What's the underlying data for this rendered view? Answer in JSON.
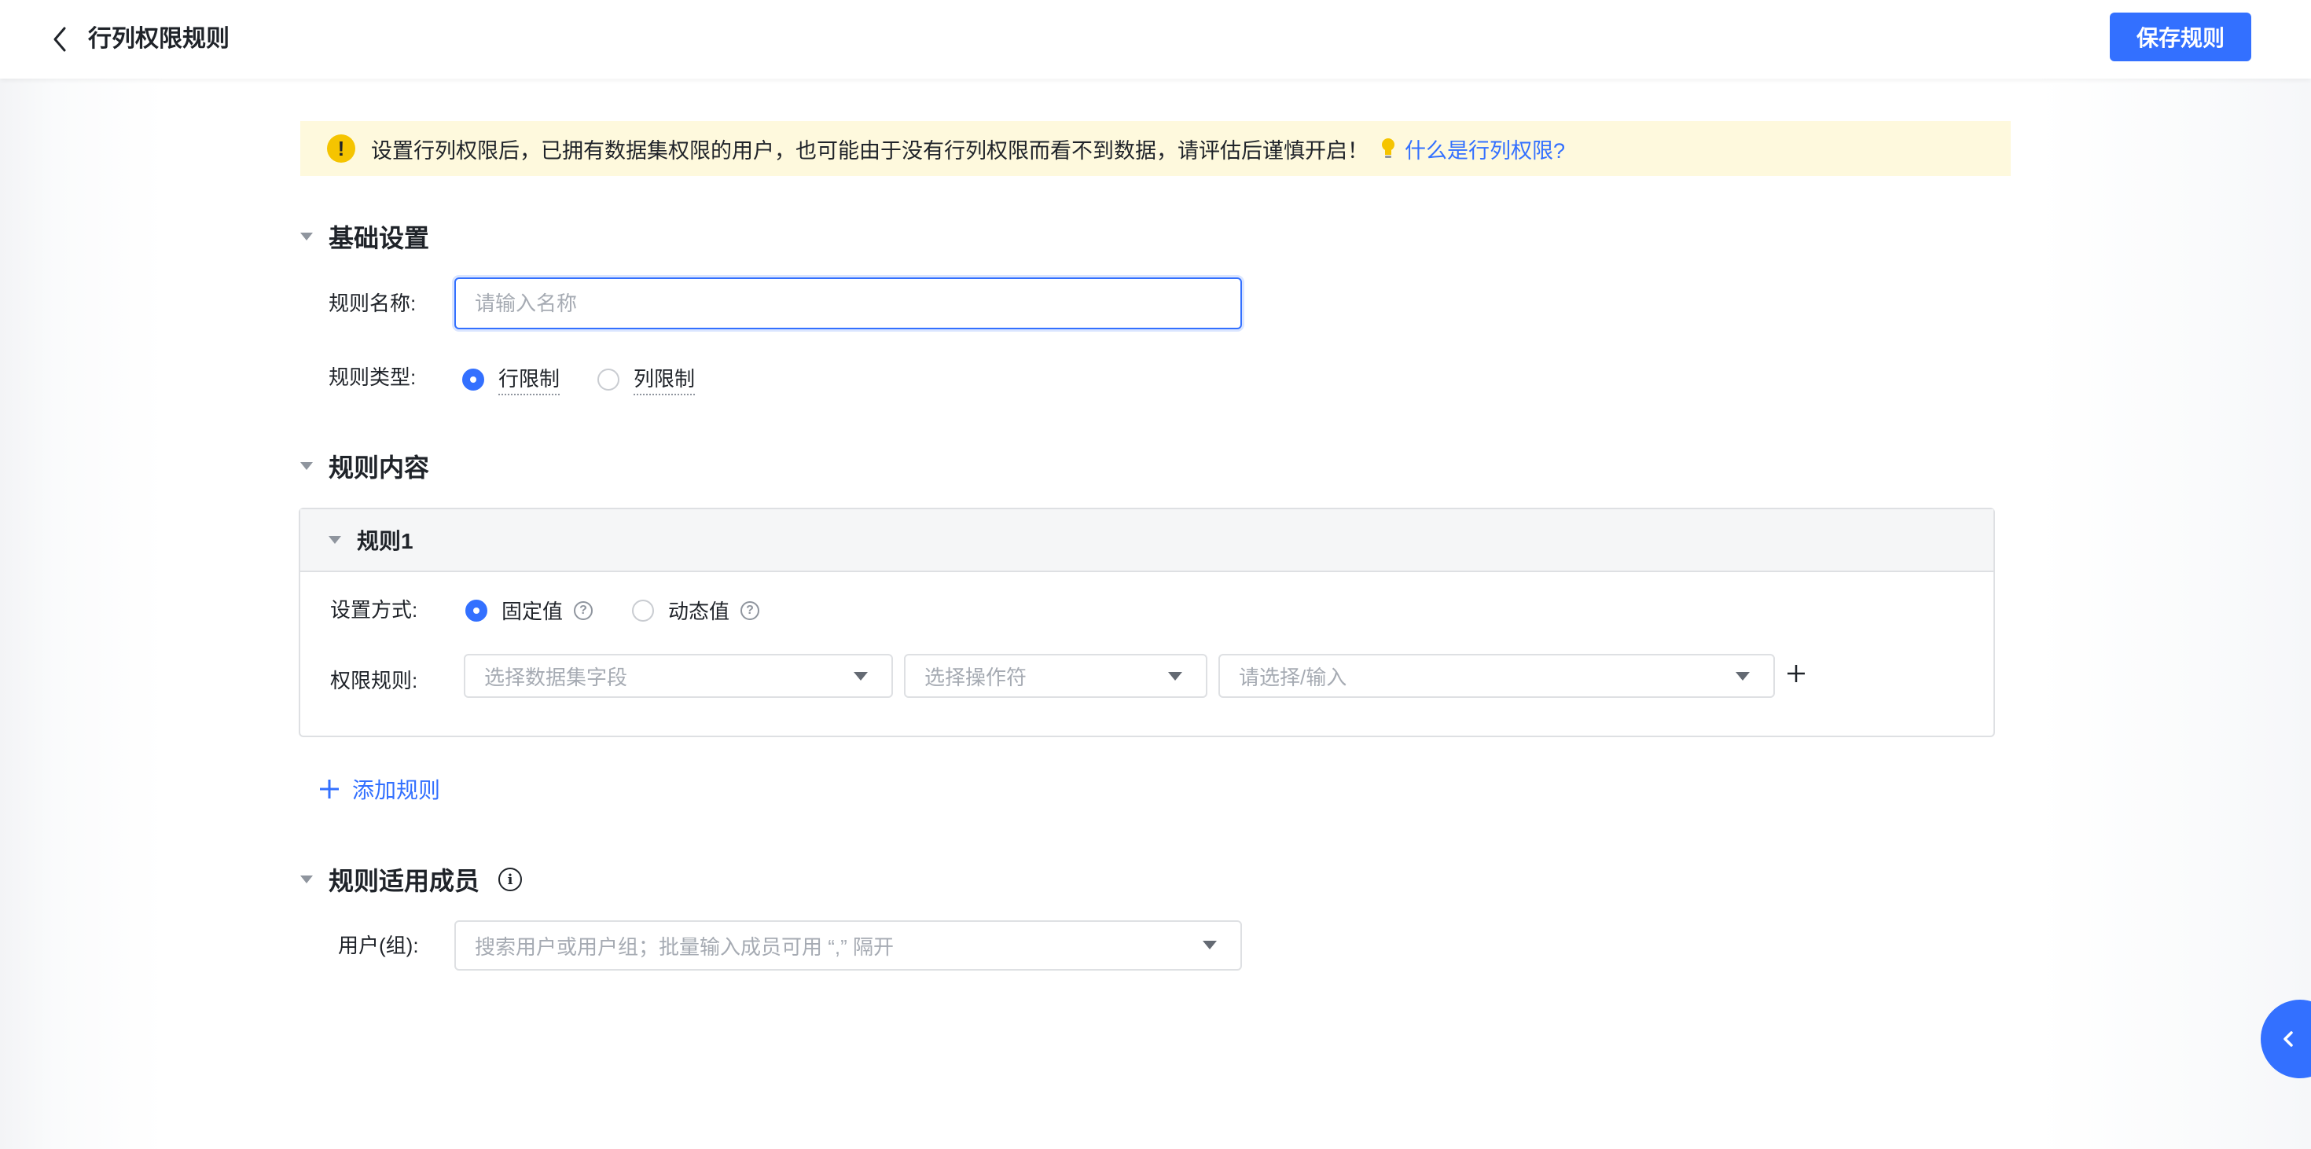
{
  "header": {
    "title": "行列权限规则",
    "save_label": "保存规则"
  },
  "notice": {
    "text": "设置行列权限后，已拥有数据集权限的用户，也可能由于没有行列权限而看不到数据，请评估后谨慎开启！",
    "link": "什么是行列权限?"
  },
  "basic": {
    "heading": "基础设置",
    "name_label": "规则名称:",
    "name_value": "",
    "name_placeholder": "请输入名称",
    "type_label": "规则类型:",
    "type_options": [
      "行限制",
      "列限制"
    ],
    "type_selected": "行限制"
  },
  "content": {
    "heading": "规则内容",
    "rule": {
      "title": "规则1",
      "mode_label": "设置方式:",
      "mode_options": [
        "固定值",
        "动态值"
      ],
      "mode_selected": "固定值",
      "permission_label": "权限规则:",
      "field_placeholder": "选择数据集字段",
      "operator_placeholder": "选择操作符",
      "value_placeholder": "请选择/输入"
    },
    "add_rule_label": "添加规则"
  },
  "members": {
    "heading": "规则适用成员",
    "user_label": "用户(组):",
    "user_placeholder": "搜索用户或用户组；批量输入成员可用 “,” 隔开"
  },
  "colors": {
    "accent": "#3370ff",
    "notice_bg": "#fef9dd",
    "warning": "#f5c400"
  }
}
